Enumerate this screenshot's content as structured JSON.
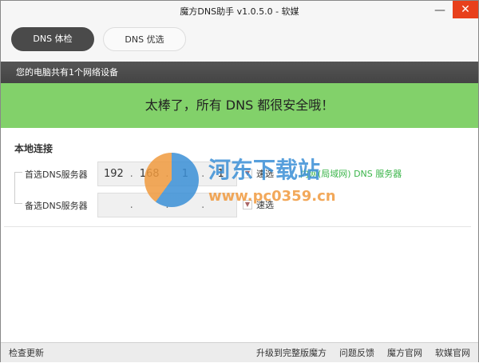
{
  "window": {
    "title": "魔方DNS助手 v1.0.5.0 - 软媒",
    "minimize": "—",
    "close": "✕"
  },
  "tabs": [
    {
      "label": "DNS 体检"
    },
    {
      "label": "DNS 优选"
    }
  ],
  "device_bar": "您的电脑共有1个网络设备",
  "banner": "太棒了，所有 DNS 都很安全哦！",
  "section": {
    "title": "本地连接",
    "primary": {
      "label": "首选DNS服务器",
      "ip": [
        "192",
        "168",
        "1",
        "1"
      ],
      "quick": "速选",
      "note": "内网(局域网) DNS 服务器"
    },
    "secondary": {
      "label": "备选DNS服务器",
      "ip": [
        "",
        "",
        "",
        ""
      ],
      "quick": "速选"
    }
  },
  "watermark": {
    "name": "河东下载站",
    "url": "www.pc0359.cn"
  },
  "footer": {
    "check_update": "检查更新",
    "links": [
      "升级到完整版魔方",
      "问题反馈",
      "魔方官网",
      "软媒官网"
    ]
  }
}
